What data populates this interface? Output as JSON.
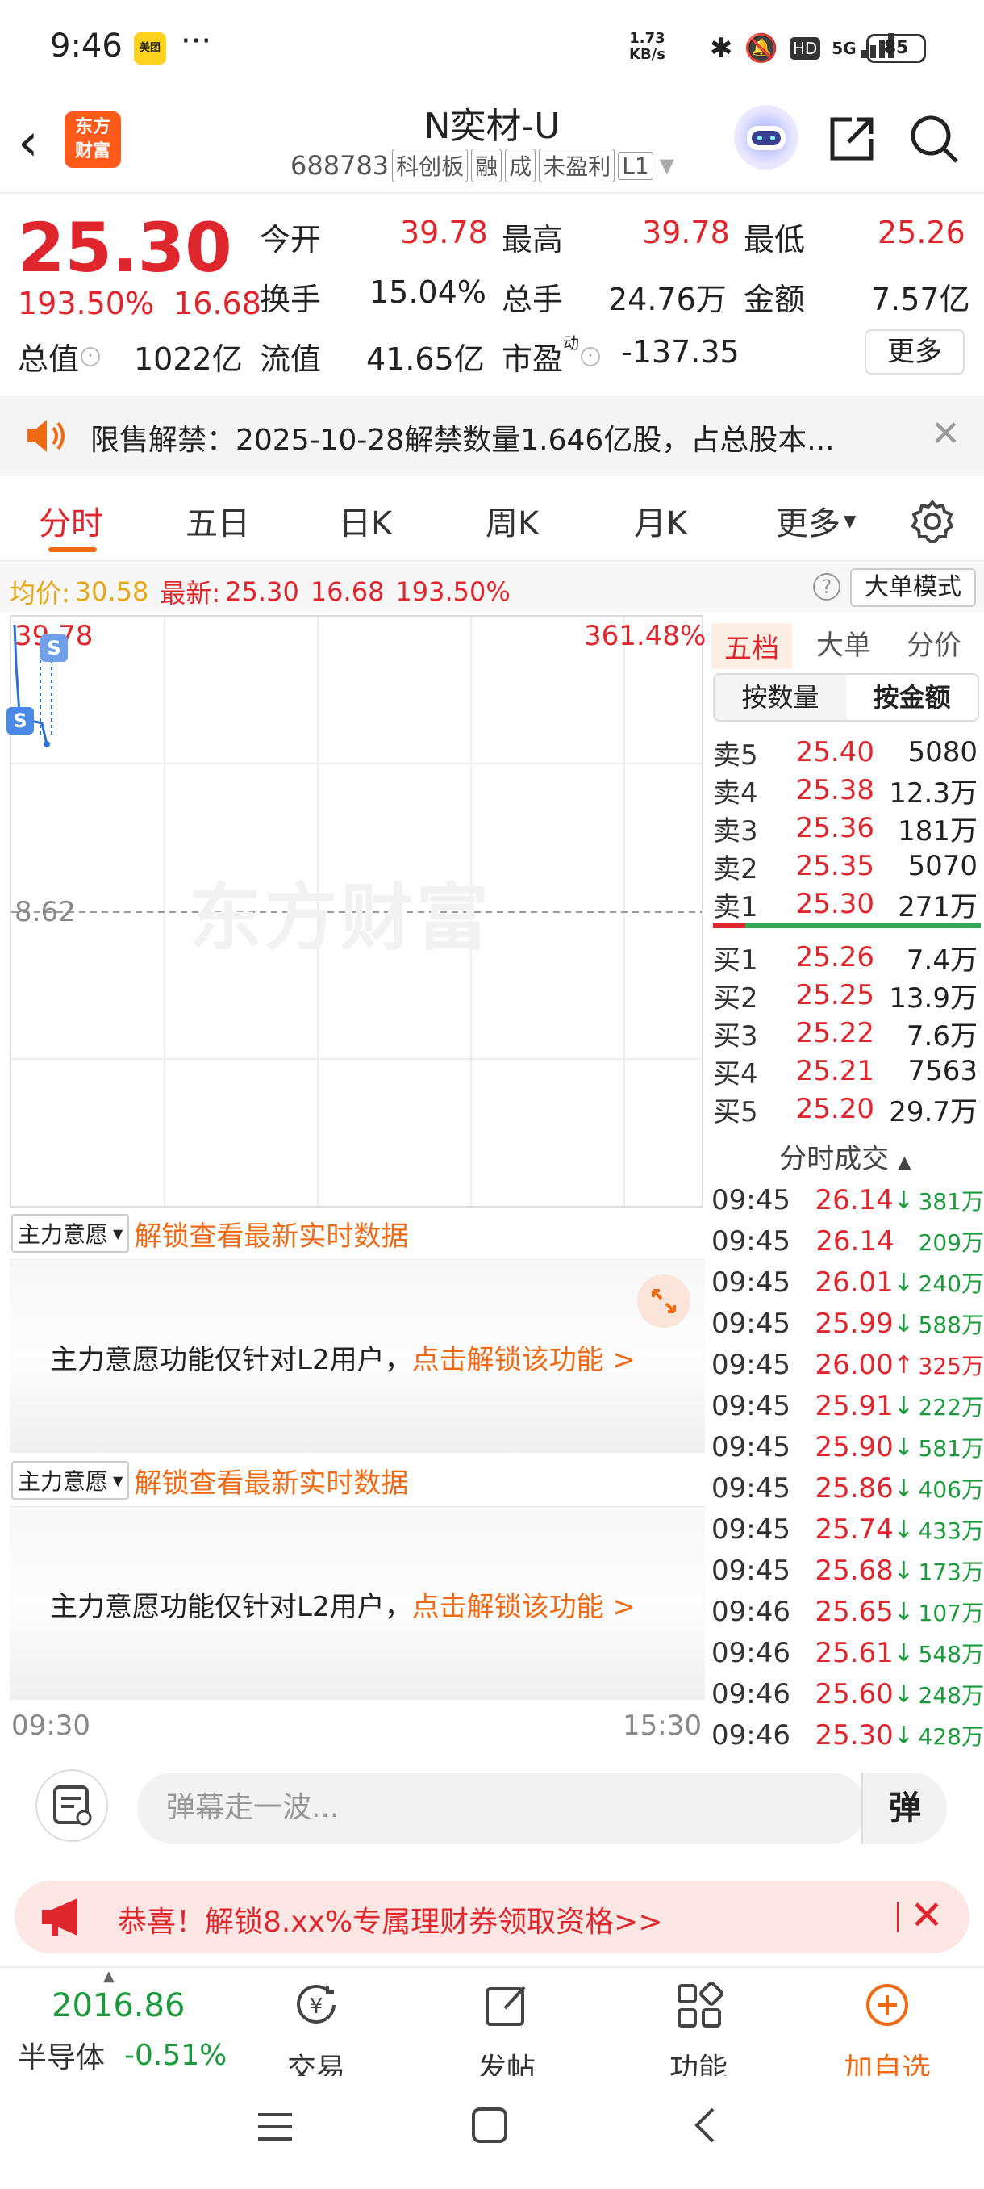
{
  "status_bar": {
    "time": "9:46",
    "app_badge": "美团",
    "dots": "···",
    "net_speed_top": "1.73",
    "net_speed_bottom": "KB/s",
    "net_type": "5G",
    "battery": "85"
  },
  "header": {
    "logo_line1": "东方",
    "logo_line2": "财富",
    "stock_name": "N奕材-U",
    "stock_code": "688783",
    "tags": [
      "科创板",
      "融",
      "成",
      "未盈利",
      "L1"
    ]
  },
  "quote": {
    "price": "25.30",
    "change_pct": "193.50%",
    "change_amt": "16.68",
    "fields": [
      {
        "label": "今开",
        "value": "39.78",
        "color": "red"
      },
      {
        "label": "最高",
        "value": "39.78",
        "color": "red"
      },
      {
        "label": "最低",
        "value": "25.26",
        "color": "red"
      },
      {
        "label": "换手",
        "value": "15.04%",
        "color": "black"
      },
      {
        "label": "总手",
        "value": "24.76万",
        "color": "black"
      },
      {
        "label": "金额",
        "value": "7.57亿",
        "color": "black"
      },
      {
        "label": "总值",
        "value": "1022亿",
        "color": "black"
      },
      {
        "label": "流值",
        "value": "41.65亿",
        "color": "black"
      },
      {
        "label": "市盈",
        "value": "-137.35",
        "color": "black"
      }
    ],
    "pe_superscript": "动",
    "more_label": "更多"
  },
  "notice": {
    "text": "限售解禁：2025-10-28解禁数量1.646亿股，占总股本..."
  },
  "tabs": [
    "分时",
    "五日",
    "日K",
    "周K",
    "月K",
    "更多"
  ],
  "avg_row": {
    "avg_label": "均价:",
    "avg_value": "30.58",
    "latest_label": "最新:",
    "latest_price": "25.30",
    "latest_change": "16.68",
    "latest_pct": "193.50%",
    "big_order_label": "大单模式"
  },
  "chart": {
    "top_price": "39.78",
    "top_pct": "361.48%",
    "mid_price": "8.62",
    "watermark": "东方财富",
    "start_time": "09:30",
    "end_time": "15:30"
  },
  "order_book": {
    "tabs": [
      "五档",
      "大单",
      "分价"
    ],
    "segments": [
      "按数量",
      "按金额"
    ],
    "asks": [
      {
        "label": "卖5",
        "price": "25.40",
        "volume": "5080"
      },
      {
        "label": "卖4",
        "price": "25.38",
        "volume": "12.3万"
      },
      {
        "label": "卖3",
        "price": "25.36",
        "volume": "181万"
      },
      {
        "label": "卖2",
        "price": "25.35",
        "volume": "5070"
      },
      {
        "label": "卖1",
        "price": "25.30",
        "volume": "271万"
      }
    ],
    "bids": [
      {
        "label": "买1",
        "price": "25.26",
        "volume": "7.4万"
      },
      {
        "label": "买2",
        "price": "25.25",
        "volume": "13.9万"
      },
      {
        "label": "买3",
        "price": "25.22",
        "volume": "7.6万"
      },
      {
        "label": "买4",
        "price": "25.21",
        "volume": "7563"
      },
      {
        "label": "买5",
        "price": "25.20",
        "volume": "29.7万"
      }
    ],
    "ticks_title": "分时成交",
    "ticks": [
      {
        "time": "09:45",
        "price": "26.14",
        "dir": "down",
        "volume": "381万"
      },
      {
        "time": "09:45",
        "price": "26.14",
        "dir": "none",
        "volume": "209万"
      },
      {
        "time": "09:45",
        "price": "26.01",
        "dir": "down",
        "volume": "240万"
      },
      {
        "time": "09:45",
        "price": "25.99",
        "dir": "down",
        "volume": "588万"
      },
      {
        "time": "09:45",
        "price": "26.00",
        "dir": "up",
        "volume": "325万"
      },
      {
        "time": "09:45",
        "price": "25.91",
        "dir": "down",
        "volume": "222万"
      },
      {
        "time": "09:45",
        "price": "25.90",
        "dir": "down",
        "volume": "581万"
      },
      {
        "time": "09:45",
        "price": "25.86",
        "dir": "down",
        "volume": "406万"
      },
      {
        "time": "09:45",
        "price": "25.74",
        "dir": "down",
        "volume": "433万"
      },
      {
        "time": "09:45",
        "price": "25.68",
        "dir": "down",
        "volume": "173万"
      },
      {
        "time": "09:46",
        "price": "25.65",
        "dir": "down",
        "volume": "107万"
      },
      {
        "time": "09:46",
        "price": "25.61",
        "dir": "down",
        "volume": "548万"
      },
      {
        "time": "09:46",
        "price": "25.60",
        "dir": "down",
        "volume": "248万"
      },
      {
        "time": "09:46",
        "price": "25.30",
        "dir": "down",
        "volume": "428万"
      }
    ]
  },
  "l2": {
    "dropdown_label": "主力意愿",
    "unlock_link": "解锁查看最新实时数据",
    "panel_text": "主力意愿功能仅针对L2用户，",
    "panel_link": "点击解锁该功能 >"
  },
  "comment_bar": {
    "placeholder": "弹幕走一波...",
    "danmu_label": "弹"
  },
  "promo": {
    "text": "恭喜！解锁8.xx%专属理财券领取资格>>"
  },
  "bottom_nav": {
    "index_value": "2016.86",
    "index_name": "半导体",
    "index_change": "-0.51%",
    "items": [
      "交易",
      "发帖",
      "功能",
      "加自选"
    ]
  }
}
